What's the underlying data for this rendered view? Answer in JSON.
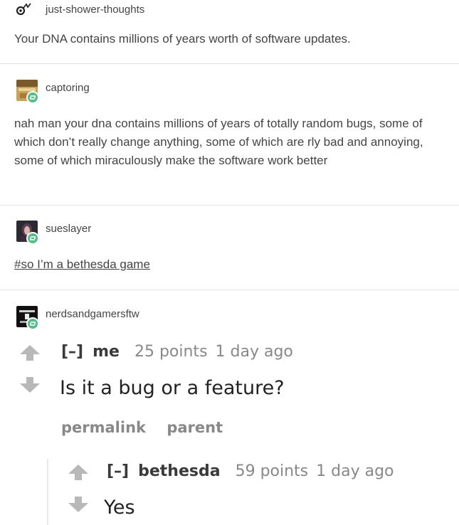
{
  "posts": [
    {
      "username": "just-shower-thoughts",
      "text": "Your DNA contains millions of years worth of software updates."
    },
    {
      "username": "captoring",
      "text": "nah man your dna contains millions of years of totally random bugs, some of which don’t really change anything, some of which are rly bad and annoying, some of which miraculously make the software work better"
    },
    {
      "username": "sueslayer",
      "text": "#so I’m a bethesda game"
    },
    {
      "username": "nerdsandgamersftw"
    }
  ],
  "reddit": {
    "comment": {
      "toggle": "[–]",
      "author": "me",
      "points": "25 points",
      "age": "1 day ago",
      "body": "Is it a bug or a feature?",
      "actions": [
        "permalink",
        "parent"
      ]
    },
    "reply": {
      "toggle": "[–]",
      "author": "bethesda",
      "points": "59 points",
      "age": "1 day ago",
      "body": "Yes"
    }
  },
  "colors": {
    "reblog": "#56bc8a",
    "divider": "#e3e3e3",
    "vote_arrow": "#b8b8b8"
  }
}
